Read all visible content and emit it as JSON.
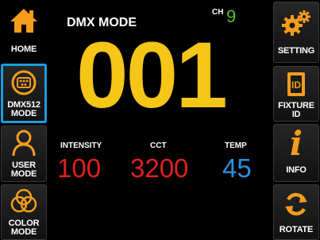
{
  "left_sidebar": {
    "items": [
      {
        "name": "home",
        "label1": "HOME",
        "label2": "",
        "icon": "home-icon"
      },
      {
        "name": "dmx512-mode",
        "label1": "DMX512",
        "label2": "MODE",
        "icon": "dmx-connector-icon",
        "selected": true
      },
      {
        "name": "user-mode",
        "label1": "USER",
        "label2": "MODE",
        "icon": "user-icon"
      },
      {
        "name": "color-mode",
        "label1": "COLOR",
        "label2": "MODE",
        "icon": "color-circles-icon"
      }
    ]
  },
  "right_sidebar": {
    "items": [
      {
        "name": "setting",
        "label1": "SETTING",
        "label2": "",
        "icon": "gears-icon"
      },
      {
        "name": "fixture-id",
        "label1": "FIXTURE",
        "label2": "ID",
        "icon": "id-card-icon"
      },
      {
        "name": "info",
        "label1": "INFO",
        "label2": "",
        "icon": "info-icon"
      },
      {
        "name": "rotate",
        "label1": "ROTATE",
        "label2": "",
        "icon": "rotate-icon"
      }
    ]
  },
  "main": {
    "title": "DMX MODE",
    "channel_label": "CH",
    "channel_value": "9",
    "address": "001",
    "params": [
      {
        "label": "INTENSITY",
        "value": "100"
      },
      {
        "label": "CCT",
        "value": "3200"
      },
      {
        "label": "TEMP",
        "value": "45"
      }
    ]
  },
  "colors": {
    "accent_orange": "#f39c1e",
    "address_yellow": "#f5c518",
    "channel_green": "#55c12a",
    "value_red": "#e0201e",
    "value_blue": "#2b8fe0",
    "selected_border": "#1a9de0"
  }
}
